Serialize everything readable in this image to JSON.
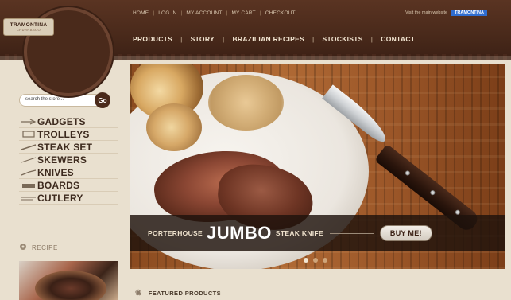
{
  "header": {
    "utility_nav": [
      "HOME",
      "LOG IN",
      "MY ACCOUNT",
      "MY CART",
      "CHECKOUT"
    ],
    "main_nav": [
      "PRODUCTS",
      "STORY",
      "BRAZILIAN RECIPES",
      "STOCKISTS",
      "CONTACT"
    ],
    "visit_text": "Visit the main website",
    "visit_badge": "TRAMONTINA"
  },
  "logo": {
    "line1": "TRAMONTINA",
    "line2": "CHURRASCO"
  },
  "search": {
    "placeholder": "search the store...",
    "go_label": "Go"
  },
  "categories": [
    {
      "label": "GADGETS",
      "icon": "gadget-icon"
    },
    {
      "label": "TROLLEYS",
      "icon": "trolley-icon"
    },
    {
      "label": "STEAK SET",
      "icon": "steak-set-icon"
    },
    {
      "label": "SKEWERS",
      "icon": "skewer-icon"
    },
    {
      "label": "KNIVES",
      "icon": "knife-icon"
    },
    {
      "label": "BOARDS",
      "icon": "board-icon"
    },
    {
      "label": "CUTLERY",
      "icon": "cutlery-icon"
    }
  ],
  "recipe": {
    "label": "RECIPE"
  },
  "hero": {
    "pre": "PORTERHOUSE",
    "big": "JUMBO",
    "post": "STEAK KNIFE",
    "cta": "BUY ME!",
    "slides": 3,
    "active_slide": 1
  },
  "featured": {
    "label": "FEATURED PRODUCTS"
  }
}
